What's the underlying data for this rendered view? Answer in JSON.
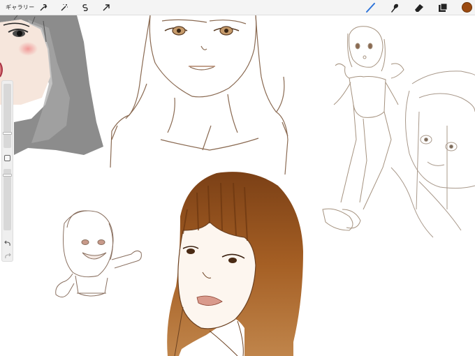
{
  "toolbar": {
    "gallery_label": "ギャラリー",
    "left_tools": [
      "wrench-icon",
      "magic-wand-icon",
      "selection-icon",
      "transform-arrow-icon"
    ],
    "right_tools": [
      "brush-icon",
      "smudge-icon",
      "eraser-icon",
      "layers-icon"
    ],
    "active_tool": "brush-icon",
    "current_color": "#9b4a10"
  },
  "sidebar": {
    "brush_size_level": 0.22,
    "opacity_level": 0.92,
    "undo_icon": "undo-icon",
    "redo_icon": "redo-icon"
  },
  "canvas": {
    "ink_color": "#8a5a32",
    "sketch_color": "#9a7a62",
    "paint_color": "#a35c22"
  }
}
